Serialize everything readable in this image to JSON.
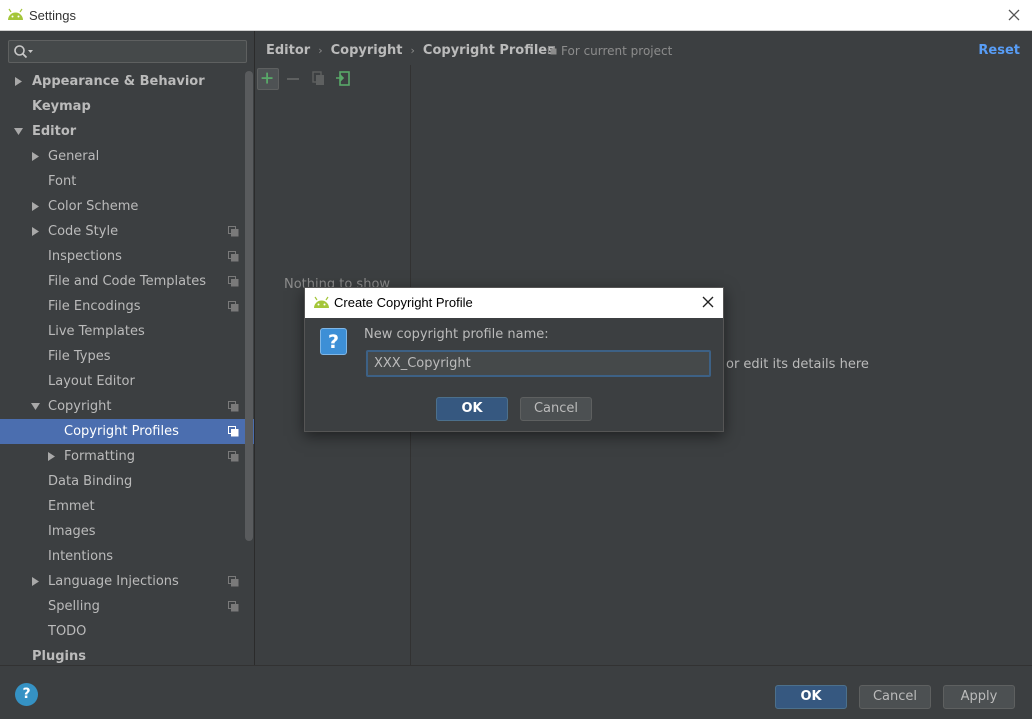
{
  "window": {
    "title": "Settings"
  },
  "search": {
    "placeholder": ""
  },
  "tree": [
    {
      "label": "Appearance & Behavior",
      "level": 0,
      "arrow": "right",
      "bold": true,
      "project": false,
      "selected": false
    },
    {
      "label": "Keymap",
      "level": 0,
      "arrow": "none",
      "bold": true,
      "project": false,
      "selected": false
    },
    {
      "label": "Editor",
      "level": 0,
      "arrow": "down",
      "bold": true,
      "project": false,
      "selected": false
    },
    {
      "label": "General",
      "level": 1,
      "arrow": "right",
      "bold": false,
      "project": false,
      "selected": false
    },
    {
      "label": "Font",
      "level": 1,
      "arrow": "none",
      "bold": false,
      "project": false,
      "selected": false
    },
    {
      "label": "Color Scheme",
      "level": 1,
      "arrow": "right",
      "bold": false,
      "project": false,
      "selected": false
    },
    {
      "label": "Code Style",
      "level": 1,
      "arrow": "right",
      "bold": false,
      "project": true,
      "selected": false
    },
    {
      "label": "Inspections",
      "level": 1,
      "arrow": "none",
      "bold": false,
      "project": true,
      "selected": false
    },
    {
      "label": "File and Code Templates",
      "level": 1,
      "arrow": "none",
      "bold": false,
      "project": true,
      "selected": false
    },
    {
      "label": "File Encodings",
      "level": 1,
      "arrow": "none",
      "bold": false,
      "project": true,
      "selected": false
    },
    {
      "label": "Live Templates",
      "level": 1,
      "arrow": "none",
      "bold": false,
      "project": false,
      "selected": false
    },
    {
      "label": "File Types",
      "level": 1,
      "arrow": "none",
      "bold": false,
      "project": false,
      "selected": false
    },
    {
      "label": "Layout Editor",
      "level": 1,
      "arrow": "none",
      "bold": false,
      "project": false,
      "selected": false
    },
    {
      "label": "Copyright",
      "level": 1,
      "arrow": "down",
      "bold": false,
      "project": true,
      "selected": false
    },
    {
      "label": "Copyright Profiles",
      "level": 2,
      "arrow": "none",
      "bold": false,
      "project": true,
      "selected": true
    },
    {
      "label": "Formatting",
      "level": 2,
      "arrow": "right",
      "bold": false,
      "project": true,
      "selected": false
    },
    {
      "label": "Data Binding",
      "level": 1,
      "arrow": "none",
      "bold": false,
      "project": false,
      "selected": false
    },
    {
      "label": "Emmet",
      "level": 1,
      "arrow": "none",
      "bold": false,
      "project": false,
      "selected": false
    },
    {
      "label": "Images",
      "level": 1,
      "arrow": "none",
      "bold": false,
      "project": false,
      "selected": false
    },
    {
      "label": "Intentions",
      "level": 1,
      "arrow": "none",
      "bold": false,
      "project": false,
      "selected": false
    },
    {
      "label": "Language Injections",
      "level": 1,
      "arrow": "right",
      "bold": false,
      "project": true,
      "selected": false
    },
    {
      "label": "Spelling",
      "level": 1,
      "arrow": "none",
      "bold": false,
      "project": true,
      "selected": false
    },
    {
      "label": "TODO",
      "level": 1,
      "arrow": "none",
      "bold": false,
      "project": false,
      "selected": false
    },
    {
      "label": "Plugins",
      "level": 0,
      "arrow": "none",
      "bold": true,
      "project": false,
      "selected": false
    }
  ],
  "breadcrumb": {
    "part1": "Editor",
    "part2": "Copyright",
    "part3": "Copyright Profiles",
    "separator": "›"
  },
  "scope": {
    "label": "For current project"
  },
  "reset_label": "Reset",
  "panel": {
    "empty_text": "Nothing to show",
    "hint_text": "or edit its details here"
  },
  "footer": {
    "help": "?",
    "ok": "OK",
    "cancel": "Cancel",
    "apply": "Apply"
  },
  "dialog": {
    "title": "Create Copyright Profile",
    "question_icon": "?",
    "prompt": "New copyright profile name:",
    "input_value": "XXX_Copyright",
    "ok": "OK",
    "cancel": "Cancel"
  },
  "colors": {
    "background": "#3c3f41",
    "selection": "#4b6eaf",
    "link": "#589df6",
    "primary_button": "#365880",
    "add_green": "#59a869",
    "android_green": "#a4c639"
  }
}
